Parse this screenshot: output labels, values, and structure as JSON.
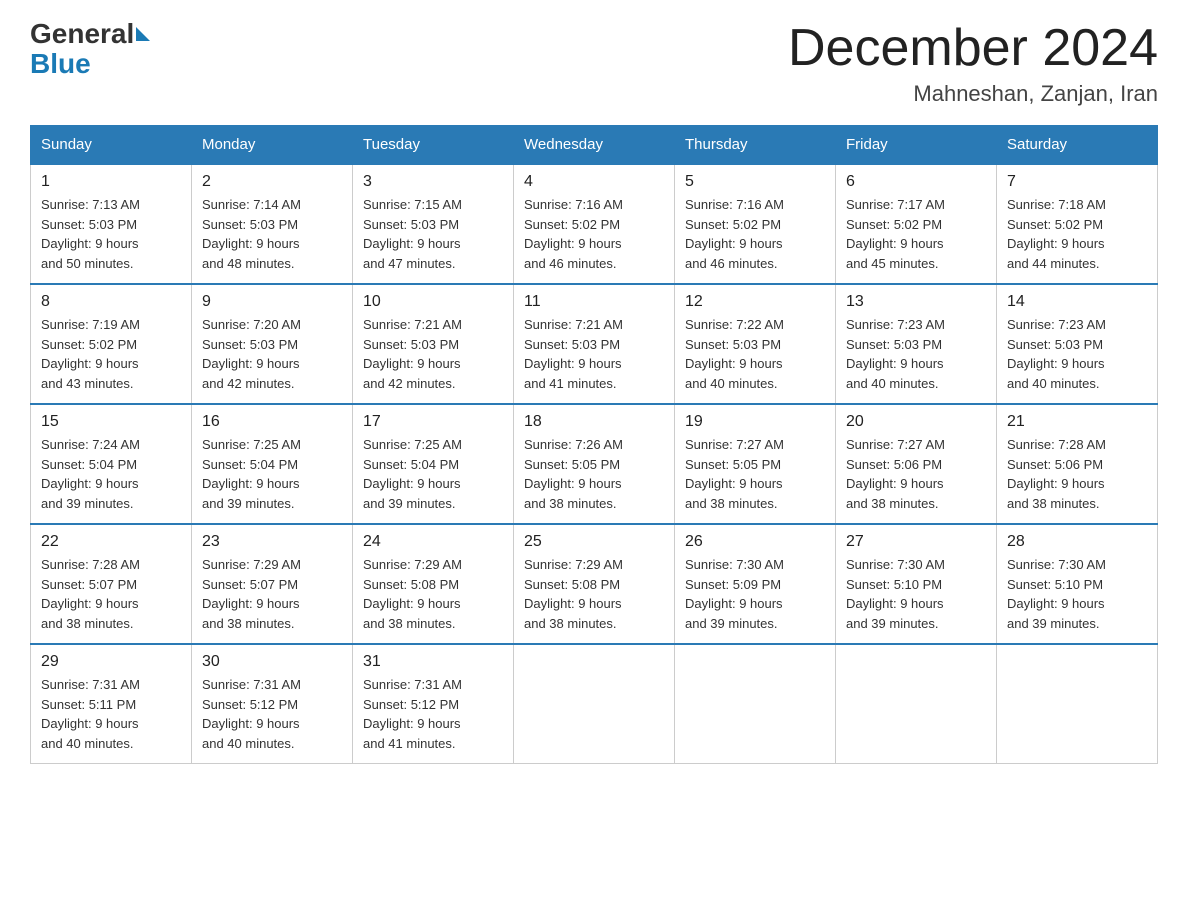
{
  "header": {
    "logo_general": "General",
    "logo_blue": "Blue",
    "month_title": "December 2024",
    "location": "Mahneshan, Zanjan, Iran"
  },
  "days_of_week": [
    "Sunday",
    "Monday",
    "Tuesday",
    "Wednesday",
    "Thursday",
    "Friday",
    "Saturday"
  ],
  "weeks": [
    [
      {
        "day": "1",
        "sunrise": "7:13 AM",
        "sunset": "5:03 PM",
        "daylight": "9 hours and 50 minutes."
      },
      {
        "day": "2",
        "sunrise": "7:14 AM",
        "sunset": "5:03 PM",
        "daylight": "9 hours and 48 minutes."
      },
      {
        "day": "3",
        "sunrise": "7:15 AM",
        "sunset": "5:03 PM",
        "daylight": "9 hours and 47 minutes."
      },
      {
        "day": "4",
        "sunrise": "7:16 AM",
        "sunset": "5:02 PM",
        "daylight": "9 hours and 46 minutes."
      },
      {
        "day": "5",
        "sunrise": "7:16 AM",
        "sunset": "5:02 PM",
        "daylight": "9 hours and 46 minutes."
      },
      {
        "day": "6",
        "sunrise": "7:17 AM",
        "sunset": "5:02 PM",
        "daylight": "9 hours and 45 minutes."
      },
      {
        "day": "7",
        "sunrise": "7:18 AM",
        "sunset": "5:02 PM",
        "daylight": "9 hours and 44 minutes."
      }
    ],
    [
      {
        "day": "8",
        "sunrise": "7:19 AM",
        "sunset": "5:02 PM",
        "daylight": "9 hours and 43 minutes."
      },
      {
        "day": "9",
        "sunrise": "7:20 AM",
        "sunset": "5:03 PM",
        "daylight": "9 hours and 42 minutes."
      },
      {
        "day": "10",
        "sunrise": "7:21 AM",
        "sunset": "5:03 PM",
        "daylight": "9 hours and 42 minutes."
      },
      {
        "day": "11",
        "sunrise": "7:21 AM",
        "sunset": "5:03 PM",
        "daylight": "9 hours and 41 minutes."
      },
      {
        "day": "12",
        "sunrise": "7:22 AM",
        "sunset": "5:03 PM",
        "daylight": "9 hours and 40 minutes."
      },
      {
        "day": "13",
        "sunrise": "7:23 AM",
        "sunset": "5:03 PM",
        "daylight": "9 hours and 40 minutes."
      },
      {
        "day": "14",
        "sunrise": "7:23 AM",
        "sunset": "5:03 PM",
        "daylight": "9 hours and 40 minutes."
      }
    ],
    [
      {
        "day": "15",
        "sunrise": "7:24 AM",
        "sunset": "5:04 PM",
        "daylight": "9 hours and 39 minutes."
      },
      {
        "day": "16",
        "sunrise": "7:25 AM",
        "sunset": "5:04 PM",
        "daylight": "9 hours and 39 minutes."
      },
      {
        "day": "17",
        "sunrise": "7:25 AM",
        "sunset": "5:04 PM",
        "daylight": "9 hours and 39 minutes."
      },
      {
        "day": "18",
        "sunrise": "7:26 AM",
        "sunset": "5:05 PM",
        "daylight": "9 hours and 38 minutes."
      },
      {
        "day": "19",
        "sunrise": "7:27 AM",
        "sunset": "5:05 PM",
        "daylight": "9 hours and 38 minutes."
      },
      {
        "day": "20",
        "sunrise": "7:27 AM",
        "sunset": "5:06 PM",
        "daylight": "9 hours and 38 minutes."
      },
      {
        "day": "21",
        "sunrise": "7:28 AM",
        "sunset": "5:06 PM",
        "daylight": "9 hours and 38 minutes."
      }
    ],
    [
      {
        "day": "22",
        "sunrise": "7:28 AM",
        "sunset": "5:07 PM",
        "daylight": "9 hours and 38 minutes."
      },
      {
        "day": "23",
        "sunrise": "7:29 AM",
        "sunset": "5:07 PM",
        "daylight": "9 hours and 38 minutes."
      },
      {
        "day": "24",
        "sunrise": "7:29 AM",
        "sunset": "5:08 PM",
        "daylight": "9 hours and 38 minutes."
      },
      {
        "day": "25",
        "sunrise": "7:29 AM",
        "sunset": "5:08 PM",
        "daylight": "9 hours and 38 minutes."
      },
      {
        "day": "26",
        "sunrise": "7:30 AM",
        "sunset": "5:09 PM",
        "daylight": "9 hours and 39 minutes."
      },
      {
        "day": "27",
        "sunrise": "7:30 AM",
        "sunset": "5:10 PM",
        "daylight": "9 hours and 39 minutes."
      },
      {
        "day": "28",
        "sunrise": "7:30 AM",
        "sunset": "5:10 PM",
        "daylight": "9 hours and 39 minutes."
      }
    ],
    [
      {
        "day": "29",
        "sunrise": "7:31 AM",
        "sunset": "5:11 PM",
        "daylight": "9 hours and 40 minutes."
      },
      {
        "day": "30",
        "sunrise": "7:31 AM",
        "sunset": "5:12 PM",
        "daylight": "9 hours and 40 minutes."
      },
      {
        "day": "31",
        "sunrise": "7:31 AM",
        "sunset": "5:12 PM",
        "daylight": "9 hours and 41 minutes."
      },
      null,
      null,
      null,
      null
    ]
  ],
  "labels": {
    "sunrise": "Sunrise:",
    "sunset": "Sunset:",
    "daylight": "Daylight:"
  },
  "colors": {
    "header_bg": "#2a7ab5",
    "border_top": "#2a7ab5"
  }
}
